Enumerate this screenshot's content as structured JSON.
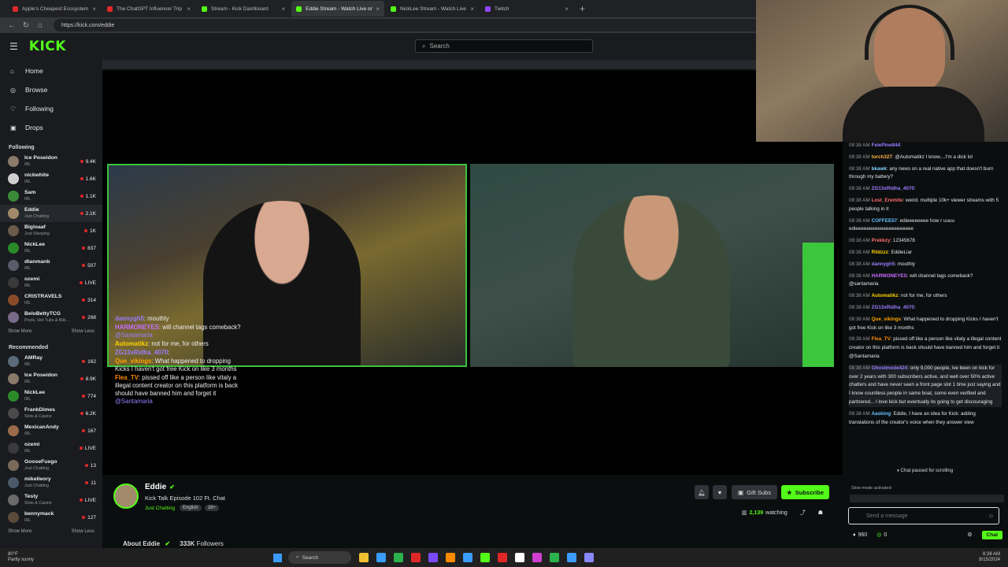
{
  "browser": {
    "tabs": [
      {
        "title": "Apple's Cheapest Ecosystem Broke",
        "color": "#e02828"
      },
      {
        "title": "The ChatGPT Influencer Trip Just Got",
        "color": "#e02828"
      },
      {
        "title": "Stream - Kick Dashboard",
        "color": "#53fc18"
      },
      {
        "title": "Eddie Stream - Watch Live on",
        "color": "#53fc18"
      },
      {
        "title": "NickLee Stream - Watch Live on",
        "color": "#53fc18"
      },
      {
        "title": "Twitch",
        "color": "#9146ff"
      }
    ],
    "url": "https://kick.com/eddie"
  },
  "kick": {
    "logo": "KICK",
    "search_placeholder": "Search",
    "nav": [
      "Home",
      "Browse",
      "Following",
      "Drops"
    ],
    "following_title": "Following",
    "recommended_title": "Recommended",
    "show_more": "Show More",
    "show_less": "Show Less",
    "following": [
      {
        "name": "Ice Poseidon",
        "cat": "IRL",
        "viewers": "9.4K",
        "color": "#8a7a6a"
      },
      {
        "name": "nickwhite",
        "cat": "IRL",
        "viewers": "1.6K",
        "color": "#cfcfcf"
      },
      {
        "name": "Sam",
        "cat": "IRL",
        "viewers": "1.1K",
        "color": "#3a8a3a"
      },
      {
        "name": "Eddie",
        "cat": "Just Chatting",
        "viewers": "2.1K",
        "color": "#a08a6a"
      },
      {
        "name": "Bigloaaf",
        "cat": "Just Sleeping",
        "viewers": "1K",
        "color": "#6a5a4a"
      },
      {
        "name": "NickLee",
        "cat": "IRL",
        "viewers": "837",
        "color": "#2a8a2a"
      },
      {
        "name": "dtanmanb",
        "cat": "IRL",
        "viewers": "507",
        "color": "#5a5a6a"
      },
      {
        "name": "ozemi",
        "cat": "IRL",
        "viewers": "LIVE",
        "color": "#3a3a3a"
      },
      {
        "name": "CRISTRAVELS",
        "cat": "IRL",
        "viewers": "314",
        "color": "#8a4a2a"
      },
      {
        "name": "BeloBettyTCG",
        "cat": "Pools, Hot Tubs & Biki...",
        "viewers": "298",
        "color": "#7a6a8a"
      }
    ],
    "recommended": [
      {
        "name": "AMRay",
        "cat": "IRL",
        "viewers": "162",
        "color": "#5a6a7a"
      },
      {
        "name": "Ice Poseidon",
        "cat": "IRL",
        "viewers": "8.9K",
        "color": "#8a7a6a"
      },
      {
        "name": "NickLee",
        "cat": "IRL",
        "viewers": "774",
        "color": "#2a8a2a"
      },
      {
        "name": "FrankDimes",
        "cat": "Slots & Casino",
        "viewers": "6.2K",
        "color": "#4a4a4a"
      },
      {
        "name": "MexicanAndy",
        "cat": "IRL",
        "viewers": "167",
        "color": "#9a6a4a"
      },
      {
        "name": "ozemi",
        "cat": "IRL",
        "viewers": "LIVE",
        "color": "#3a3a3a"
      },
      {
        "name": "GooseFuego",
        "cat": "Just Chatting",
        "viewers": "13",
        "color": "#7a6a5a"
      },
      {
        "name": "mikelleory",
        "cat": "Just Chatting",
        "viewers": "11",
        "color": "#4a5a6a"
      },
      {
        "name": "Testy",
        "cat": "Slots & Casino",
        "viewers": "LIVE",
        "color": "#6a6a6a"
      },
      {
        "name": "bennymack",
        "cat": "IRL",
        "viewers": "127",
        "color": "#5a4a3a"
      }
    ]
  },
  "overlay_chat": [
    {
      "user": "dannygh5",
      "color": "#9b7dff",
      "text": ": mouthly"
    },
    {
      "user": "HARMONEYES",
      "color": "#c86dff",
      "text": ": will channel tags comeback? ",
      "mention": "@Santamaria"
    },
    {
      "user": "Automatikz",
      "color": "#ffd400",
      "text": ": not for me, for others"
    },
    {
      "user": "ZG13xRidha_4070",
      "color": "#9b7dff",
      "text": ":"
    },
    {
      "user": "Que_vikings",
      "color": "#ffa500",
      "text": ": What happened to dropping Kicks I haven't got free Kick on like 3 months"
    },
    {
      "user": "Flea_TV",
      "color": "#ff8c00",
      "text": ": pissed off like a person like vitaly a illegal content creator on this platform is back should have banned him and forget it ",
      "mention": "@Santamaria"
    }
  ],
  "stream": {
    "name": "Eddie",
    "title": "Kick Talk Episode 102 Ft. Chat",
    "category": "Just Chatting",
    "tags": [
      "English",
      "18+"
    ],
    "gift_subs": "Gift Subs",
    "subscribe": "Subscribe",
    "watching_count": "2,139",
    "watching_label": "watching",
    "about": "About Eddie",
    "followers": "333K",
    "followers_label": "Followers"
  },
  "chat": {
    "messages": [
      {
        "time": "08:38 AM",
        "user": "FelePine844",
        "color": "#9b7dff",
        "text": ":"
      },
      {
        "time": "08:38 AM",
        "user": "torch327",
        "color": "#ffb347",
        "text": ": @Automatikz I know....I'm a dick lol"
      },
      {
        "time": "08:38 AM",
        "user": "bkawk",
        "color": "#7fd4ff",
        "text": ": any news on a real native app that doesn't burn through my battery?"
      },
      {
        "time": "08:38 AM",
        "user": "ZG13xRidha_4070",
        "color": "#9b7dff",
        "text": ":"
      },
      {
        "time": "08:38 AM",
        "user": "Lost_Eremite",
        "color": "#ff6b6b",
        "text": ": weird. multiple 10k+ viewer streams with 5 people talking in it"
      },
      {
        "time": "08:38 AM",
        "user": "COFFEE57",
        "color": "#66c2ff",
        "text": ": edieeeeeeee how r uuuu edieeeeeeeeeeeeeeeeeeeee"
      },
      {
        "time": "08:38 AM",
        "user": "Prekkzy",
        "color": "#ff6b6b",
        "text": ": 12345678"
      },
      {
        "time": "08:38 AM",
        "user": "Rildzzz",
        "color": "#ffd400",
        "text": ": EddieLiar"
      },
      {
        "time": "08:38 AM",
        "user": "dannygh5",
        "color": "#9b7dff",
        "text": ": mouthly"
      },
      {
        "time": "08:38 AM",
        "user": "HARMONEYES",
        "color": "#c86dff",
        "text": ": will channel tags comeback? @santamaria"
      },
      {
        "time": "08:38 AM",
        "user": "Automatikz",
        "color": "#ffd400",
        "text": ": not for me, for others"
      },
      {
        "time": "08:38 AM",
        "user": "ZG13xRidha_4070",
        "color": "#9b7dff",
        "text": ":"
      },
      {
        "time": "08:38 AM",
        "user": "Que_vikings",
        "color": "#ffa500",
        "text": ": What happened to dropping Kicks I haven't got free Kick on like 3 months"
      },
      {
        "time": "08:38 AM",
        "user": "Flea_TV",
        "color": "#ff8c00",
        "text": ": pissed off like a person like vitaly a illegal content creator on this platform is back should have banned him and forget it @Santamaria"
      },
      {
        "time": "08:38 AM",
        "user": "Ghostmode424",
        "color": "#9b7dff",
        "text": ": only 9,000 people, ive been on kick for over 2 years with 300 subscribers active, and well over 50% active chatters and have never seen a front page slot 1 time just saying and I know countless people in same boat, some even verified and partnered... I love kick but eventually its going to get discouraging"
      },
      {
        "time": "08:38 AM",
        "user": "Aasking",
        "color": "#66c2ff",
        "text": ": Eddie, I have an idea for Kick: adding translations of the creator's voice when they answer view"
      }
    ],
    "paused": "Chat paused for scrolling",
    "slow_mode": "Slow mode activated",
    "placeholder": "Send a message",
    "points": "960",
    "points2": "0",
    "send": "Chat"
  },
  "taskbar": {
    "weather_temp": "80°F",
    "weather_desc": "Partly sunny",
    "search": "Search",
    "time": "8:38 AM",
    "date": "8/15/2024"
  }
}
